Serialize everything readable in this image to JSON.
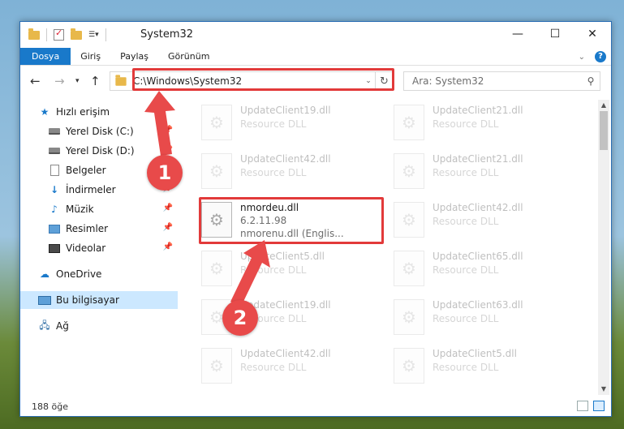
{
  "window": {
    "title": "System32"
  },
  "ribbon": {
    "tabs": [
      "Dosya",
      "Giriş",
      "Paylaş",
      "Görünüm"
    ]
  },
  "address": {
    "path": "C:\\Windows\\System32"
  },
  "search": {
    "placeholder": "Ara: System32"
  },
  "sidebar": {
    "quick_access": "Hızlı erişim",
    "items": [
      "Yerel Disk (C:)",
      "Yerel Disk (D:)",
      "Belgeler",
      "İndirmeler",
      "Müzik",
      "Resimler",
      "Videolar"
    ],
    "onedrive": "OneDrive",
    "this_pc": "Bu bilgisayar",
    "network": "Ağ"
  },
  "files": [
    {
      "name": "UpdateClient19.dll",
      "sub": "Resource DLL"
    },
    {
      "name": "UpdateClient21.dll",
      "sub": "Resource DLL"
    },
    {
      "name": "UpdateClient42.dll",
      "sub": "Resource DLL"
    },
    {
      "name": "UpdateClient21.dll",
      "sub": "Resource DLL"
    },
    {
      "name": "nmordeu.dll",
      "sub": "6.2.11.98",
      "sub2": "nmorenu.dll (Englis..."
    },
    {
      "name": "UpdateClient42.dll",
      "sub": "Resource DLL"
    },
    {
      "name": "UpdateClient5.dll",
      "sub": "Resource DLL"
    },
    {
      "name": "UpdateClient65.dll",
      "sub": "Resource DLL"
    },
    {
      "name": "UpdateClient19.dll",
      "sub": "Resource DLL"
    },
    {
      "name": "UpdateClient63.dll",
      "sub": "Resource DLL"
    },
    {
      "name": "UpdateClient42.dll",
      "sub": "Resource DLL"
    },
    {
      "name": "UpdateClient5.dll",
      "sub": "Resource DLL"
    }
  ],
  "status": {
    "count": "188 öğe"
  },
  "annotations": {
    "step1": "1",
    "step2": "2"
  },
  "colors": {
    "accent": "#1979ca",
    "highlight": "#e23a3a",
    "badge": "#e84a4a"
  }
}
